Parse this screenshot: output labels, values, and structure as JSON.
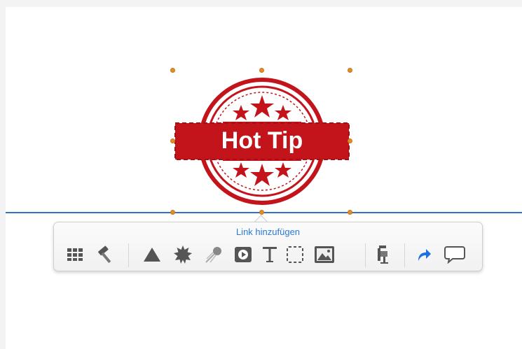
{
  "stamp": {
    "text": "Hot Tip",
    "colors": {
      "red": "#c4141b",
      "white": "#ffffff"
    }
  },
  "toolbar": {
    "link_label": "Link hinzufügen",
    "tools": [
      {
        "icon": "table-icon"
      },
      {
        "icon": "hammer-icon"
      },
      {
        "icon": "shape-icon"
      },
      {
        "icon": "burst-icon"
      },
      {
        "icon": "comet-icon"
      },
      {
        "icon": "video-icon"
      },
      {
        "icon": "text-icon"
      },
      {
        "icon": "selection-icon"
      },
      {
        "icon": "image-icon"
      },
      {
        "icon": "clamp-icon"
      },
      {
        "icon": "redo-icon"
      },
      {
        "icon": "comment-icon"
      }
    ]
  },
  "colors": {
    "accent_blue": "#2f6fd0",
    "handle_orange": "#e08e2b",
    "link_blue": "#2a7ad6"
  }
}
